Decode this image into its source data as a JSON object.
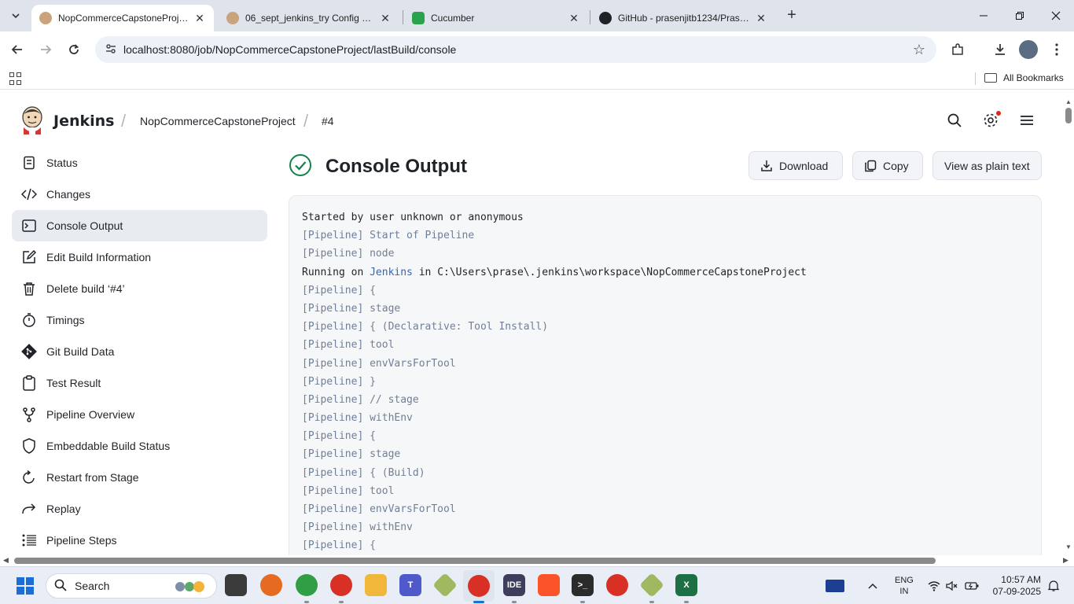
{
  "browser": {
    "tabs": [
      {
        "title": "NopCommerceCapstoneProject",
        "active": true
      },
      {
        "title": "06_sept_jenkins_try Config - Jenkins",
        "active": false
      },
      {
        "title": "Cucumber",
        "active": false
      },
      {
        "title": "GitHub - prasenjitb1234/Prasenjit",
        "active": false
      }
    ],
    "url": "localhost:8080/job/NopCommerceCapstoneProject/lastBuild/console",
    "bookmarks_label": "All Bookmarks"
  },
  "jenkins": {
    "brand": "Jenkins",
    "breadcrumb": [
      "NopCommerceCapstoneProject",
      "#4"
    ],
    "sidebar": [
      {
        "label": "Status",
        "icon": "status-icon"
      },
      {
        "label": "Changes",
        "icon": "code-icon"
      },
      {
        "label": "Console Output",
        "icon": "terminal-icon",
        "active": true
      },
      {
        "label": "Edit Build Information",
        "icon": "edit-icon"
      },
      {
        "label": "Delete build ‘#4’",
        "icon": "trash-icon"
      },
      {
        "label": "Timings",
        "icon": "stopwatch-icon"
      },
      {
        "label": "Git Build Data",
        "icon": "git-icon"
      },
      {
        "label": "Test Result",
        "icon": "clipboard-icon"
      },
      {
        "label": "Pipeline Overview",
        "icon": "pipeline-icon"
      },
      {
        "label": "Embeddable Build Status",
        "icon": "shield-icon"
      },
      {
        "label": "Restart from Stage",
        "icon": "restart-icon"
      },
      {
        "label": "Replay",
        "icon": "replay-icon"
      },
      {
        "label": "Pipeline Steps",
        "icon": "list-icon"
      }
    ],
    "page_title": "Console Output",
    "actions": {
      "download": "Download",
      "copy": "Copy",
      "plain": "View as plain text"
    },
    "console": [
      {
        "text": "Started by user unknown or anonymous",
        "pipe": false
      },
      {
        "text": "[Pipeline] Start of Pipeline",
        "pipe": true
      },
      {
        "text": "[Pipeline] node",
        "pipe": true
      },
      {
        "pre": "Running on ",
        "link": "Jenkins",
        "post": " in C:\\Users\\prase\\.jenkins\\workspace\\NopCommerceCapstoneProject",
        "pipe": false
      },
      {
        "text": "[Pipeline] {",
        "pipe": true
      },
      {
        "text": "[Pipeline] stage",
        "pipe": true
      },
      {
        "text": "[Pipeline] { (Declarative: Tool Install)",
        "pipe": true
      },
      {
        "text": "[Pipeline] tool",
        "pipe": true
      },
      {
        "text": "[Pipeline] envVarsForTool",
        "pipe": true
      },
      {
        "text": "[Pipeline] }",
        "pipe": true
      },
      {
        "text": "[Pipeline] // stage",
        "pipe": true
      },
      {
        "text": "[Pipeline] withEnv",
        "pipe": true
      },
      {
        "text": "[Pipeline] {",
        "pipe": true
      },
      {
        "text": "[Pipeline] stage",
        "pipe": true
      },
      {
        "text": "[Pipeline] { (Build)",
        "pipe": true
      },
      {
        "text": "[Pipeline] tool",
        "pipe": true
      },
      {
        "text": "[Pipeline] envVarsForTool",
        "pipe": true
      },
      {
        "text": "[Pipeline] withEnv",
        "pipe": true
      },
      {
        "text": "[Pipeline] {",
        "pipe": true
      }
    ]
  },
  "taskbar": {
    "search_placeholder": "Search",
    "lang": [
      "ENG",
      "IN"
    ],
    "time": "10:57 AM",
    "date": "07-09-2025"
  },
  "colors": {
    "accent": "#138347",
    "link": "#2a67c9",
    "pipeline_text": "#6f7f98"
  }
}
